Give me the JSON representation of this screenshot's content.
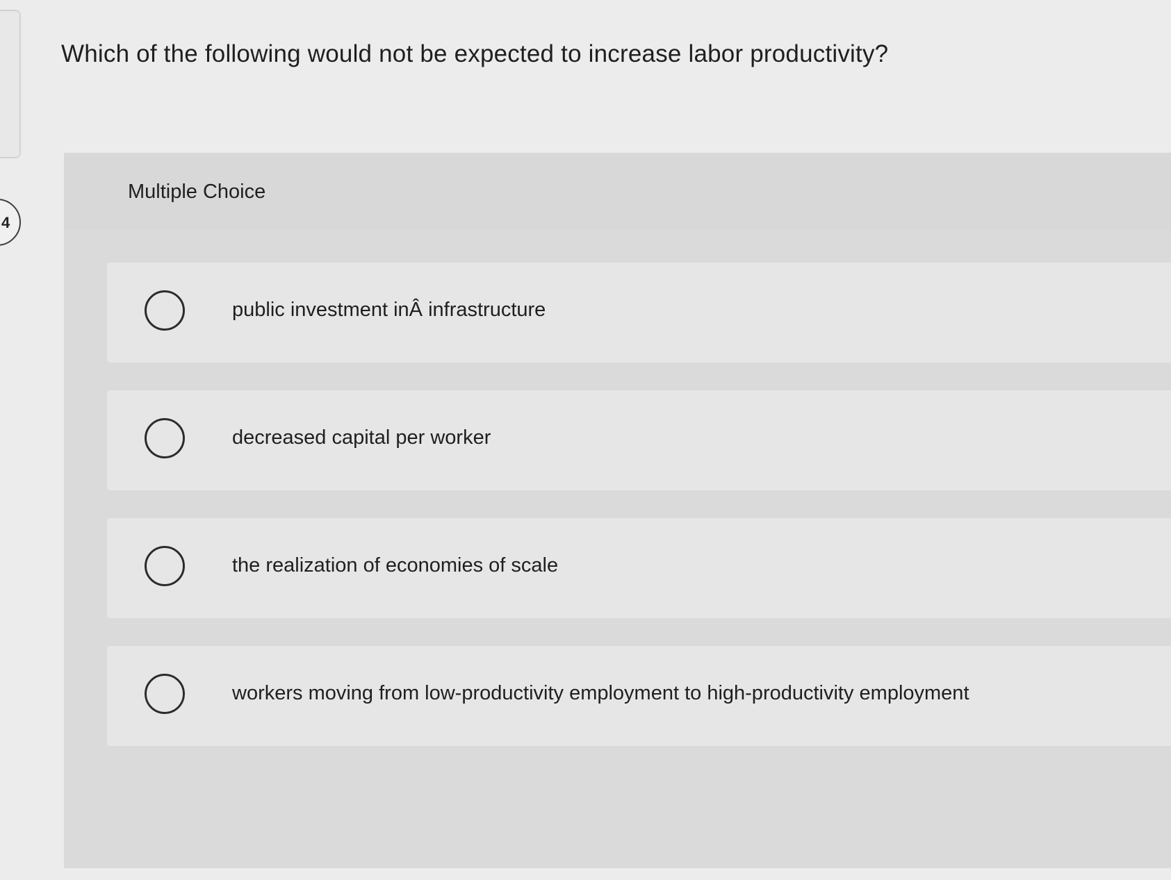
{
  "question": {
    "number": "4",
    "text": "Which of the following would not be expected to increase labor productivity?"
  },
  "panel": {
    "label": "Multiple Choice"
  },
  "choices": [
    {
      "label": "public investment inÂ infrastructure"
    },
    {
      "label": "decreased capital per worker"
    },
    {
      "label": "the realization of economies of scale"
    },
    {
      "label": "workers moving from low-productivity employment to high-productivity employment"
    }
  ]
}
